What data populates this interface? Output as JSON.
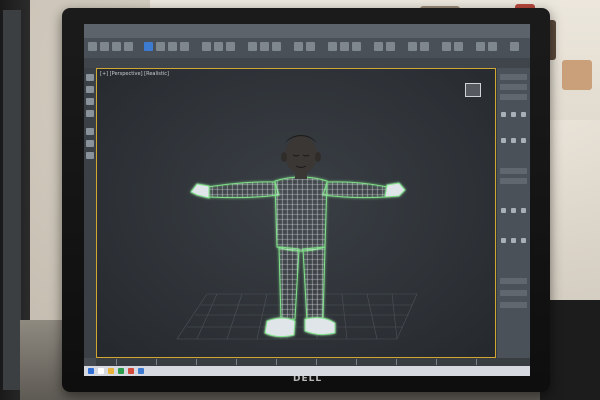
{
  "scene": {
    "monitor_brand": "DELL",
    "app": {
      "viewport_label": "[+] [Perspective] [Realistic]"
    },
    "colors": {
      "viewport_border": "#d1a733",
      "wireframe": "#e6ecef",
      "wireframe_glow": "#7fe089",
      "skin": "#3a3735"
    }
  }
}
